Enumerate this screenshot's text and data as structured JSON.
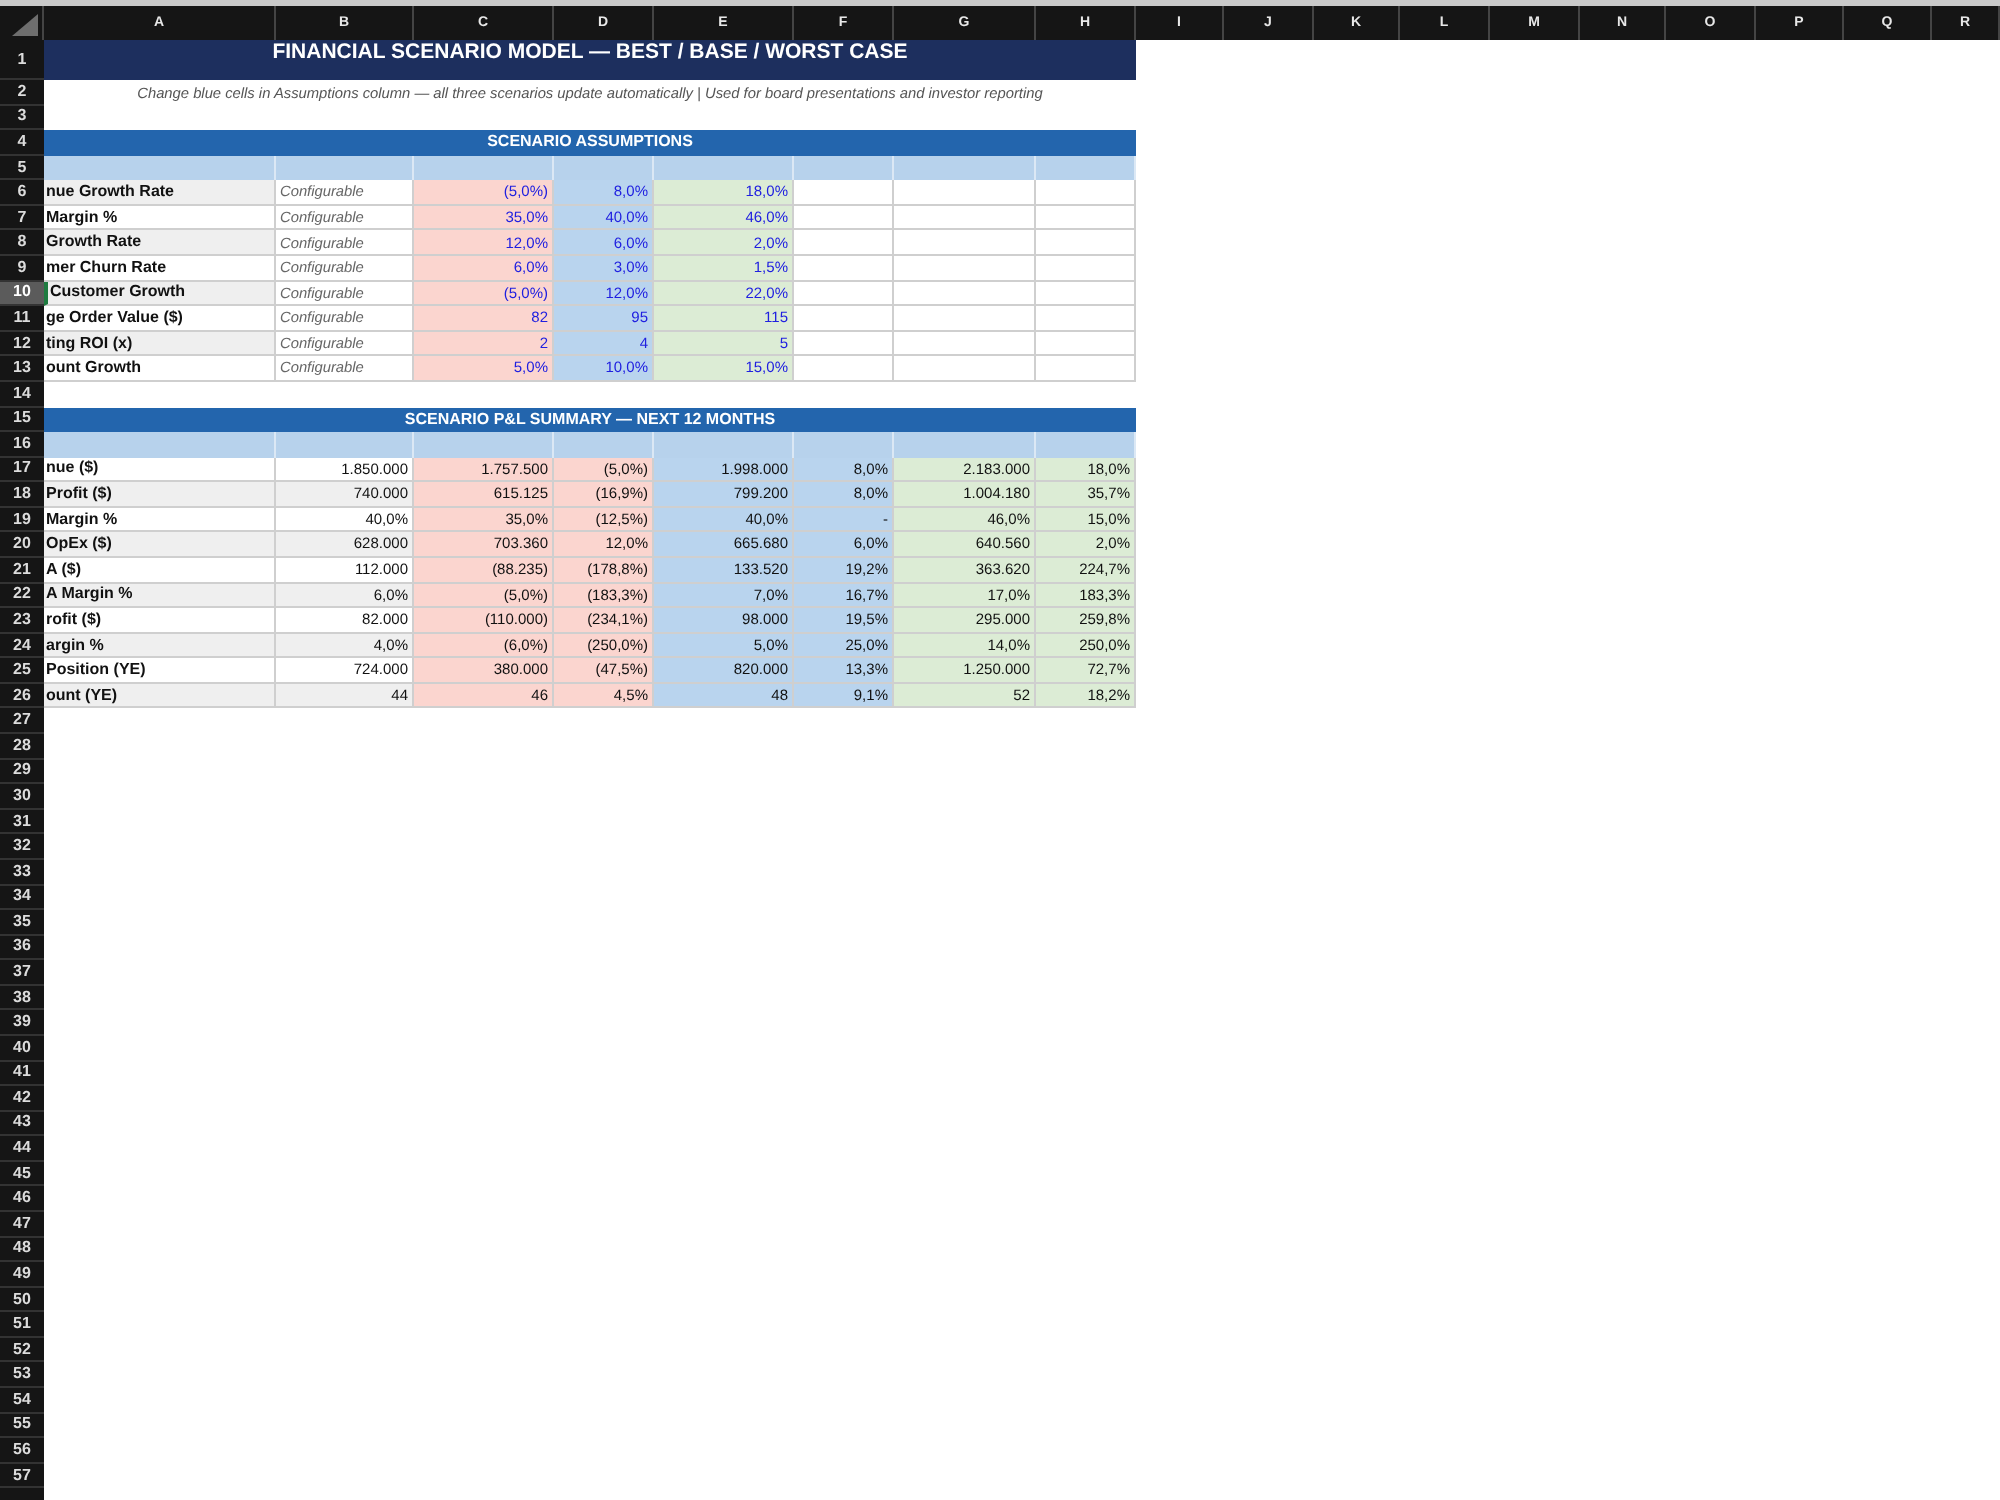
{
  "column_headers": [
    "A",
    "B",
    "C",
    "D",
    "E",
    "F",
    "G",
    "H",
    "I",
    "J",
    "K",
    "L",
    "M",
    "N",
    "O",
    "P",
    "Q",
    "R"
  ],
  "row_headers": [
    {
      "label": "1",
      "selected": false
    },
    {
      "label": "2",
      "selected": false
    },
    {
      "label": "3",
      "selected": false
    },
    {
      "label": "4",
      "selected": false
    },
    {
      "label": "5",
      "selected": false
    },
    {
      "label": "6",
      "selected": false
    },
    {
      "label": "7",
      "selected": false
    },
    {
      "label": "8",
      "selected": false
    },
    {
      "label": "9",
      "selected": false
    },
    {
      "label": "10",
      "selected": true
    },
    {
      "label": "11",
      "selected": false
    },
    {
      "label": "12",
      "selected": false
    },
    {
      "label": "13",
      "selected": false
    },
    {
      "label": "14",
      "selected": false
    },
    {
      "label": "15",
      "selected": false
    },
    {
      "label": "16",
      "selected": false
    },
    {
      "label": "17",
      "selected": false
    },
    {
      "label": "18",
      "selected": false
    },
    {
      "label": "19",
      "selected": false
    },
    {
      "label": "20",
      "selected": false
    },
    {
      "label": "21",
      "selected": false
    },
    {
      "label": "22",
      "selected": false
    },
    {
      "label": "23",
      "selected": false
    },
    {
      "label": "24",
      "selected": false
    },
    {
      "label": "25",
      "selected": false
    },
    {
      "label": "26",
      "selected": false
    },
    {
      "label": "27",
      "selected": false
    },
    {
      "label": "28",
      "selected": false
    },
    {
      "label": "29",
      "selected": false
    },
    {
      "label": "30",
      "selected": false
    },
    {
      "label": "31",
      "selected": false
    },
    {
      "label": "32",
      "selected": false
    },
    {
      "label": "33",
      "selected": false
    },
    {
      "label": "34",
      "selected": false
    },
    {
      "label": "35",
      "selected": false
    },
    {
      "label": "36",
      "selected": false
    },
    {
      "label": "37",
      "selected": false
    },
    {
      "label": "38",
      "selected": false
    },
    {
      "label": "39",
      "selected": false
    },
    {
      "label": "40",
      "selected": false
    },
    {
      "label": "41",
      "selected": false
    },
    {
      "label": "42",
      "selected": false
    },
    {
      "label": "43",
      "selected": false
    },
    {
      "label": "44",
      "selected": false
    },
    {
      "label": "45",
      "selected": false
    },
    {
      "label": "46",
      "selected": false
    },
    {
      "label": "47",
      "selected": false
    },
    {
      "label": "48",
      "selected": false
    },
    {
      "label": "49",
      "selected": false
    },
    {
      "label": "50",
      "selected": false
    },
    {
      "label": "51",
      "selected": false
    },
    {
      "label": "52",
      "selected": false
    },
    {
      "label": "53",
      "selected": false
    },
    {
      "label": "54",
      "selected": false
    },
    {
      "label": "55",
      "selected": false
    },
    {
      "label": "56",
      "selected": false
    },
    {
      "label": "57",
      "selected": false
    }
  ],
  "title": "FINANCIAL SCENARIO MODEL — BEST / BASE / WORST CASE",
  "note": "Change blue cells in Assumptions column — all three scenarios update automatically | Used for board presentations and investor reporting",
  "assumptions": {
    "header": "SCENARIO ASSUMPTIONS",
    "rows": [
      {
        "label": "nue Growth Rate",
        "cells": [
          "Configurable",
          "(5,0%)",
          "8,0%",
          "18,0%"
        ]
      },
      {
        "label": "Margin %",
        "cells": [
          "Configurable",
          "35,0%",
          "40,0%",
          "46,0%"
        ]
      },
      {
        "label": "Growth Rate",
        "cells": [
          "Configurable",
          "12,0%",
          "6,0%",
          "2,0%"
        ]
      },
      {
        "label": "mer Churn Rate",
        "cells": [
          "Configurable",
          "6,0%",
          "3,0%",
          "1,5%"
        ]
      },
      {
        "label": "Customer Growth",
        "cells": [
          "Configurable",
          "(5,0%)",
          "12,0%",
          "22,0%"
        ]
      },
      {
        "label": "ge Order Value ($)",
        "cells": [
          "Configurable",
          "82",
          "95",
          "115"
        ]
      },
      {
        "label": "ting ROI (x)",
        "cells": [
          "Configurable",
          "2",
          "4",
          "5"
        ]
      },
      {
        "label": "ount Growth",
        "cells": [
          "Configurable",
          "5,0%",
          "10,0%",
          "15,0%"
        ]
      }
    ]
  },
  "pnl_summary": {
    "header": "SCENARIO P&L SUMMARY — NEXT 12 MONTHS",
    "rows": [
      {
        "label": "nue ($)",
        "cells": [
          "1.850.000",
          "1.757.500",
          "(5,0%)",
          "1.998.000",
          "8,0%",
          "2.183.000",
          "18,0%"
        ]
      },
      {
        "label": "Profit ($)",
        "cells": [
          "740.000",
          "615.125",
          "(16,9%)",
          "799.200",
          "8,0%",
          "1.004.180",
          "35,7%"
        ]
      },
      {
        "label": "Margin %",
        "cells": [
          "40,0%",
          "35,0%",
          "(12,5%)",
          "40,0%",
          "-",
          "46,0%",
          "15,0%"
        ]
      },
      {
        "label": "OpEx ($)",
        "cells": [
          "628.000",
          "703.360",
          "12,0%",
          "665.680",
          "6,0%",
          "640.560",
          "2,0%"
        ]
      },
      {
        "label": "A ($)",
        "cells": [
          "112.000",
          "(88.235)",
          "(178,8%)",
          "133.520",
          "19,2%",
          "363.620",
          "224,7%"
        ]
      },
      {
        "label": "A Margin %",
        "cells": [
          "6,0%",
          "(5,0%)",
          "(183,3%)",
          "7,0%",
          "16,7%",
          "17,0%",
          "183,3%"
        ]
      },
      {
        "label": "rofit ($)",
        "cells": [
          "82.000",
          "(110.000)",
          "(234,1%)",
          "98.000",
          "19,5%",
          "295.000",
          "259,8%"
        ]
      },
      {
        "label": "argin %",
        "cells": [
          "4,0%",
          "(6,0%)",
          "(250,0%)",
          "5,0%",
          "25,0%",
          "14,0%",
          "250,0%"
        ]
      },
      {
        "label": "Position (YE)",
        "cells": [
          "724.000",
          "380.000",
          "(47,5%)",
          "820.000",
          "13,3%",
          "1.250.000",
          "72,7%"
        ]
      },
      {
        "label": "ount (YE)",
        "cells": [
          "44",
          "46",
          "4,5%",
          "48",
          "9,1%",
          "52",
          "18,2%"
        ]
      }
    ]
  }
}
